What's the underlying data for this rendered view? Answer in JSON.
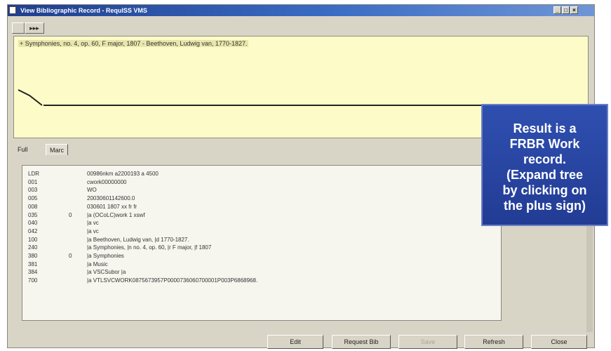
{
  "window": {
    "title": "View Bibliographic Record - RequISS VMS",
    "controls": [
      "_",
      "□",
      "×"
    ]
  },
  "toolbar": {
    "button1_label": "",
    "button2_label": "▸▸▸"
  },
  "tree": {
    "node_label": "+ Symphonies, no. 4, op. 60, F major, 1807 - Beethoven, Ludwig van, 1770-1827."
  },
  "tabs": [
    {
      "label": "Full"
    },
    {
      "label": "Marc"
    }
  ],
  "record_rows": [
    {
      "tag": "LDR",
      "ind": "",
      "value": "00986nkm a2200193 a 4500"
    },
    {
      "tag": "001",
      "ind": "",
      "value": "cwork00000000"
    },
    {
      "tag": "003",
      "ind": "",
      "value": "WO"
    },
    {
      "tag": "005",
      "ind": "",
      "value": "20030601142600.0"
    },
    {
      "tag": "008",
      "ind": "",
      "value": "030601 1807    xx      fr     fr"
    },
    {
      "tag": "035",
      "ind": "0",
      "value": "|a (OCoLC)work 1 xswf"
    },
    {
      "tag": "040",
      "ind": "",
      "value": "|a vc"
    },
    {
      "tag": "042",
      "ind": "",
      "value": "|a vc"
    },
    {
      "tag": "100",
      "ind": "",
      "value": "|a Beethoven, Ludwig van, |d 1770-1827."
    },
    {
      "tag": "240",
      "ind": "",
      "value": "|a Symphonies, |n no. 4, op. 60, |r F major, |f 1807"
    },
    {
      "tag": "380",
      "ind": "0",
      "value": "|a Symphonies"
    },
    {
      "tag": "381",
      "ind": "",
      "value": "|a Music"
    },
    {
      "tag": "384",
      "ind": "",
      "value": "|a VSCSubor    |a"
    },
    {
      "tag": "700",
      "ind": "",
      "value": "|a VTLSVCWORK0875673957P0000736060700001P003P6868968."
    }
  ],
  "buttons": {
    "edit": "Edit",
    "request_bib": "Request Bib",
    "disabled_btn": "Save",
    "refresh": "Refresh",
    "close": "Close"
  },
  "callout": {
    "lines": [
      "Result is a",
      "FRBR Work",
      "record.",
      "(Expand tree",
      "by clicking on",
      "the plus sign)"
    ],
    "color": "#2a47a6"
  }
}
